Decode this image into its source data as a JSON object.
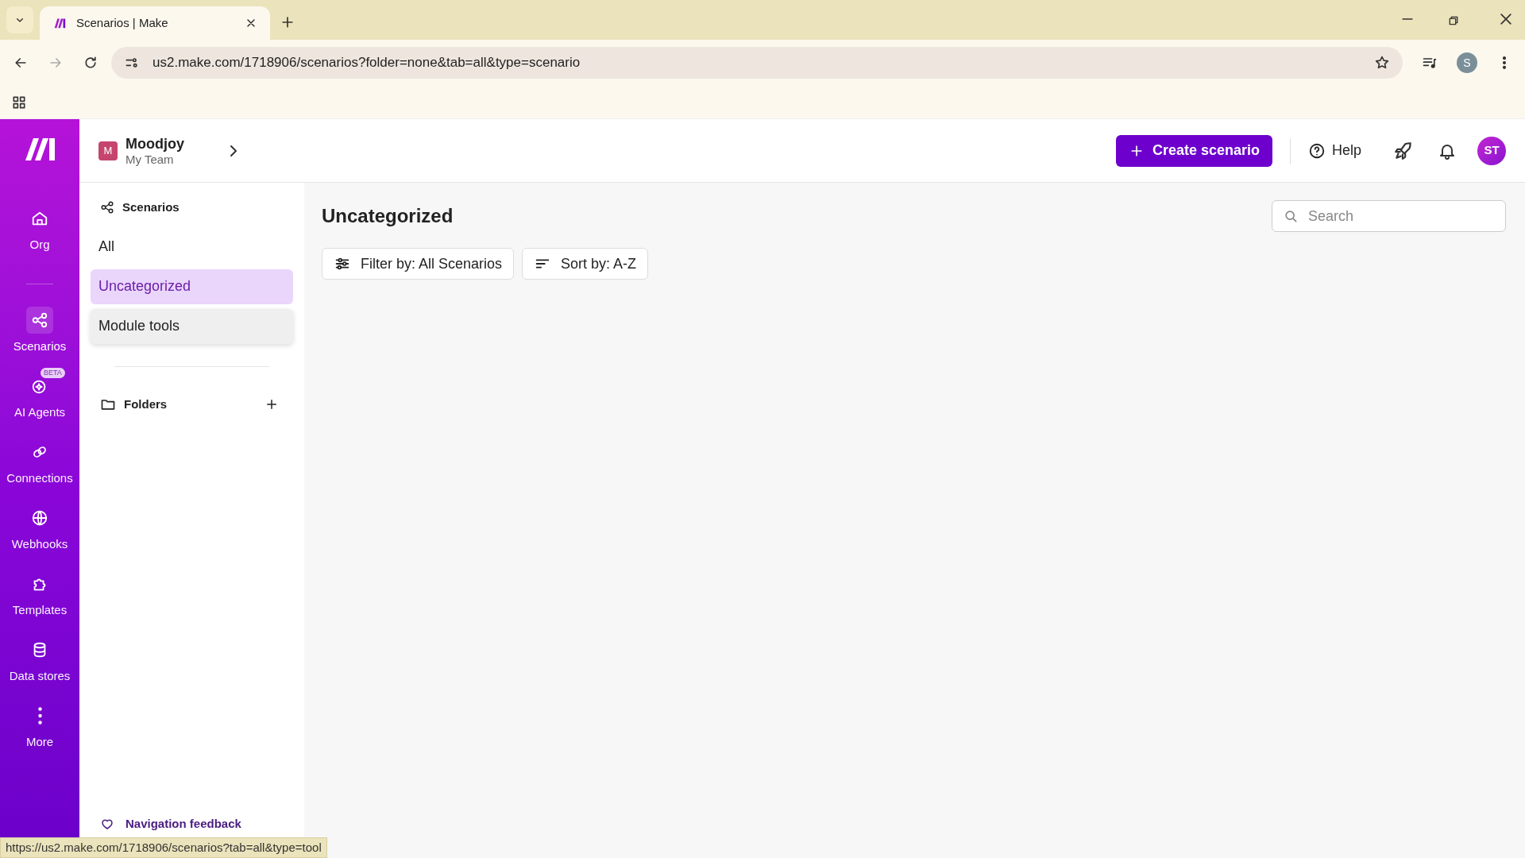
{
  "browser": {
    "tab_title": "Scenarios | Make",
    "url": "us2.make.com/1718906/scenarios?folder=none&tab=all&type=scenario",
    "profile_initial": "S",
    "status_url": "https://us2.make.com/1718906/scenarios?tab=all&type=tool"
  },
  "nav": [
    {
      "kind": "item",
      "label": "Org",
      "selected": false
    },
    {
      "kind": "divider"
    },
    {
      "kind": "item",
      "label": "Scenarios",
      "selected": true
    },
    {
      "kind": "item",
      "label": "AI Agents",
      "selected": false,
      "badge": "BETA"
    },
    {
      "kind": "item",
      "label": "Connections",
      "selected": false
    },
    {
      "kind": "item",
      "label": "Webhooks",
      "selected": false
    },
    {
      "kind": "item",
      "label": "Templates",
      "selected": false
    },
    {
      "kind": "item",
      "label": "Data stores",
      "selected": false
    },
    {
      "kind": "item",
      "label": "More",
      "selected": false
    }
  ],
  "org": {
    "initial": "M",
    "name": "Moodjoy",
    "team": "My Team"
  },
  "sidebar": {
    "heading": "Scenarios",
    "items": [
      {
        "label": "All",
        "selected": false,
        "hovered": false
      },
      {
        "label": "Uncategorized",
        "selected": true,
        "hovered": false
      },
      {
        "label": "Module tools",
        "selected": false,
        "hovered": true
      }
    ],
    "folders_label": "Folders",
    "feedback": "Navigation feedback"
  },
  "header": {
    "create_button": "Create scenario",
    "help": "Help",
    "avatar": "ST"
  },
  "main": {
    "title": "Uncategorized",
    "filter": "Filter by: All Scenarios",
    "sort": "Sort by: A-Z",
    "search": {
      "placeholder": "Search"
    }
  }
}
